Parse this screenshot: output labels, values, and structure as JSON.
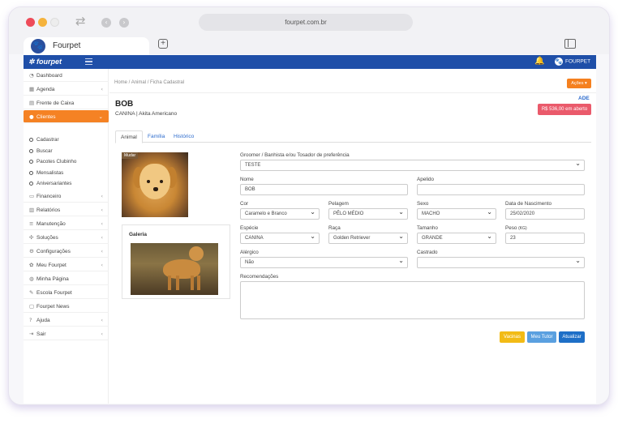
{
  "browser": {
    "url": "fourpet.com.br",
    "tab_title": "Fourpet"
  },
  "topbar": {
    "brand": "fourpet",
    "user_name": "FOURPET"
  },
  "sidebar": {
    "items": [
      {
        "label": "Dashboard",
        "icon": "dashboard-icon"
      },
      {
        "label": "Agenda",
        "icon": "calendar-icon"
      },
      {
        "label": "Frente de Caixa",
        "icon": "cash-register-icon"
      },
      {
        "label": "Clientes",
        "icon": "users-icon"
      },
      {
        "label": "Financeiro",
        "icon": "money-icon"
      },
      {
        "label": "Relatórios",
        "icon": "chart-icon"
      },
      {
        "label": "Manutenção",
        "icon": "database-icon"
      },
      {
        "label": "Soluções",
        "icon": "puzzle-icon"
      },
      {
        "label": "Configurações",
        "icon": "gear-icon"
      },
      {
        "label": "Meu Fourpet",
        "icon": "paw-icon"
      },
      {
        "label": "Minha Página",
        "icon": "globe-icon"
      },
      {
        "label": "Escola Fourpet",
        "icon": "school-icon"
      },
      {
        "label": "Fourpet News",
        "icon": "news-icon"
      },
      {
        "label": "Ajuda",
        "icon": "help-icon"
      },
      {
        "label": "Sair",
        "icon": "logout-icon"
      }
    ],
    "subitems": [
      "Cadastrar",
      "Buscar",
      "Pacotes Clubinho",
      "Mensalistas",
      "Aniversariantes"
    ]
  },
  "breadcrumb": [
    "Home",
    "Animal",
    "Ficha Cadastral"
  ],
  "actions_label": "Ações ▾",
  "status_code": "ADE",
  "pet": {
    "name": "BOB",
    "species_breed": "CANINA | Akita Americano",
    "balance": "R$ 536,00 em aberto",
    "photo_tag": "Mudar"
  },
  "tabs": [
    "Animal",
    "Família",
    "Histórico"
  ],
  "gallery_title": "Galeria",
  "form": {
    "groomer_label": "Groomer / Banhista e/ou Tosador de preferência",
    "groomer_value": "TESTE",
    "nome_label": "Nome",
    "nome_value": "BOB",
    "apelido_label": "Apelido",
    "apelido_value": "",
    "cor_label": "Cor",
    "cor_value": "Caramelo e Branco",
    "pelagem_label": "Pelagem",
    "pelagem_value": "PÊLO MÉDIO",
    "sexo_label": "Sexo",
    "sexo_value": "MACHO",
    "nasc_label": "Data de Nascimento",
    "nasc_value": "25/02/2020",
    "especie_label": "Espécie",
    "especie_value": "CANINA",
    "raca_label": "Raça",
    "raca_value": "Golden Retriever",
    "tamanho_label": "Tamanho",
    "tamanho_value": "GRANDE",
    "peso_label": "Peso",
    "peso_unit": "(KG)",
    "peso_value": "23",
    "alergico_label": "Alérgico",
    "alergico_value": "Não",
    "castrado_label": "Castrado",
    "castrado_value": "",
    "recom_label": "Recomendações"
  },
  "buttons": {
    "vacinas": "Vacinas",
    "tutor": "Meu Tutor",
    "atualizar": "Atualizar"
  },
  "colors": {
    "brand_blue": "#1f4fa8",
    "orange": "#f58224",
    "alert_red": "#ea5a6b",
    "btn_yellow": "#f2bb16",
    "btn_light_blue": "#5aa0e0",
    "btn_blue": "#1e6fc7"
  }
}
